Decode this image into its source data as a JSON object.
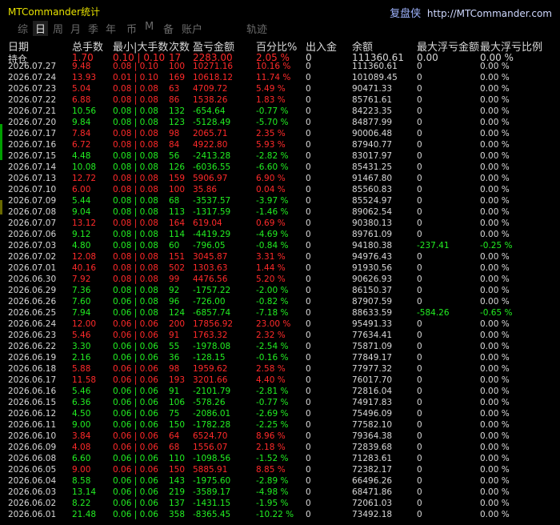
{
  "window": {
    "title": "MTCommander统计",
    "brand": "复盘侠",
    "url": "http://MTCommander.com"
  },
  "tabs": [
    "综",
    "日",
    "周",
    "月",
    "季",
    "年",
    "币",
    "M",
    "备",
    "账户",
    "轨迹"
  ],
  "active_tab": "日",
  "headers": [
    "日期",
    "总手数",
    "最小|大手数",
    "次数",
    "盈亏金额",
    "百分比%",
    "出入金",
    "余额",
    "最大浮亏金额",
    "最大浮亏比例"
  ],
  "holding": {
    "label": "持仓",
    "lots": "1.70",
    "minmax": "0.10 | 0.10",
    "count": "17",
    "pnl": "2283.00",
    "pct": "2.05 %",
    "io": "0",
    "balance": "111360.61",
    "maxfloat": "0.00",
    "maxfloatpct": "0.00 %",
    "color": "red"
  },
  "rows": [
    {
      "date": "2026.07.27",
      "lots": "9.48",
      "minmax": "0.08 | 0.10",
      "count": "100",
      "pnl": "10271.16",
      "pct": "10.16 %",
      "io": "0",
      "balance": "111360.61",
      "maxfloat": "0",
      "maxfloatpct": "0.00 %",
      "color": "red"
    },
    {
      "date": "2026.07.24",
      "lots": "13.93",
      "minmax": "0.01 | 0.10",
      "count": "169",
      "pnl": "10618.12",
      "pct": "11.74 %",
      "io": "0",
      "balance": "101089.45",
      "maxfloat": "0",
      "maxfloatpct": "0.00 %",
      "color": "red"
    },
    {
      "date": "2026.07.23",
      "lots": "5.04",
      "minmax": "0.08 | 0.08",
      "count": "63",
      "pnl": "4709.72",
      "pct": "5.49 %",
      "io": "0",
      "balance": "90471.33",
      "maxfloat": "0",
      "maxfloatpct": "0.00 %",
      "color": "red"
    },
    {
      "date": "2026.07.22",
      "lots": "6.88",
      "minmax": "0.08 | 0.08",
      "count": "86",
      "pnl": "1538.26",
      "pct": "1.83 %",
      "io": "0",
      "balance": "85761.61",
      "maxfloat": "0",
      "maxfloatpct": "0.00 %",
      "color": "red"
    },
    {
      "date": "2026.07.21",
      "lots": "10.56",
      "minmax": "0.08 | 0.08",
      "count": "132",
      "pnl": "-654.64",
      "pct": "-0.77 %",
      "io": "0",
      "balance": "84223.35",
      "maxfloat": "0",
      "maxfloatpct": "0.00 %",
      "color": "green"
    },
    {
      "date": "2026.07.20",
      "lots": "9.84",
      "minmax": "0.08 | 0.08",
      "count": "123",
      "pnl": "-5128.49",
      "pct": "-5.70 %",
      "io": "0",
      "balance": "84877.99",
      "maxfloat": "0",
      "maxfloatpct": "0.00 %",
      "color": "green"
    },
    {
      "date": "2026.07.17",
      "lots": "7.84",
      "minmax": "0.08 | 0.08",
      "count": "98",
      "pnl": "2065.71",
      "pct": "2.35 %",
      "io": "0",
      "balance": "90006.48",
      "maxfloat": "0",
      "maxfloatpct": "0.00 %",
      "color": "red"
    },
    {
      "date": "2026.07.16",
      "lots": "6.72",
      "minmax": "0.08 | 0.08",
      "count": "84",
      "pnl": "4922.80",
      "pct": "5.93 %",
      "io": "0",
      "balance": "87940.77",
      "maxfloat": "0",
      "maxfloatpct": "0.00 %",
      "color": "red"
    },
    {
      "date": "2026.07.15",
      "lots": "4.48",
      "minmax": "0.08 | 0.08",
      "count": "56",
      "pnl": "-2413.28",
      "pct": "-2.82 %",
      "io": "0",
      "balance": "83017.97",
      "maxfloat": "0",
      "maxfloatpct": "0.00 %",
      "color": "green"
    },
    {
      "date": "2026.07.14",
      "lots": "10.08",
      "minmax": "0.08 | 0.08",
      "count": "126",
      "pnl": "-6036.55",
      "pct": "-6.60 %",
      "io": "0",
      "balance": "85431.25",
      "maxfloat": "0",
      "maxfloatpct": "0.00 %",
      "color": "green"
    },
    {
      "date": "2026.07.13",
      "lots": "12.72",
      "minmax": "0.08 | 0.08",
      "count": "159",
      "pnl": "5906.97",
      "pct": "6.90 %",
      "io": "0",
      "balance": "91467.80",
      "maxfloat": "0",
      "maxfloatpct": "0.00 %",
      "color": "red"
    },
    {
      "date": "2026.07.10",
      "lots": "6.00",
      "minmax": "0.08 | 0.08",
      "count": "100",
      "pnl": "35.86",
      "pct": "0.04 %",
      "io": "0",
      "balance": "85560.83",
      "maxfloat": "0",
      "maxfloatpct": "0.00 %",
      "color": "red"
    },
    {
      "date": "2026.07.09",
      "lots": "5.44",
      "minmax": "0.08 | 0.08",
      "count": "68",
      "pnl": "-3537.57",
      "pct": "-3.97 %",
      "io": "0",
      "balance": "85524.97",
      "maxfloat": "0",
      "maxfloatpct": "0.00 %",
      "color": "green"
    },
    {
      "date": "2026.07.08",
      "lots": "9.04",
      "minmax": "0.08 | 0.08",
      "count": "113",
      "pnl": "-1317.59",
      "pct": "-1.46 %",
      "io": "0",
      "balance": "89062.54",
      "maxfloat": "0",
      "maxfloatpct": "0.00 %",
      "color": "green"
    },
    {
      "date": "2026.07.07",
      "lots": "13.12",
      "minmax": "0.08 | 0.08",
      "count": "164",
      "pnl": "619.04",
      "pct": "0.69 %",
      "io": "0",
      "balance": "90380.13",
      "maxfloat": "0",
      "maxfloatpct": "0.00 %",
      "color": "red"
    },
    {
      "date": "2026.07.06",
      "lots": "9.12",
      "minmax": "0.08 | 0.08",
      "count": "114",
      "pnl": "-4419.29",
      "pct": "-4.69 %",
      "io": "0",
      "balance": "89761.09",
      "maxfloat": "0",
      "maxfloatpct": "0.00 %",
      "color": "green"
    },
    {
      "date": "2026.07.03",
      "lots": "4.80",
      "minmax": "0.08 | 0.08",
      "count": "60",
      "pnl": "-796.05",
      "pct": "-0.84 %",
      "io": "0",
      "balance": "94180.38",
      "maxfloat": "-237.41",
      "maxfloatpct": "-0.25 %",
      "color": "green"
    },
    {
      "date": "2026.07.02",
      "lots": "12.08",
      "minmax": "0.08 | 0.08",
      "count": "151",
      "pnl": "3045.87",
      "pct": "3.31 %",
      "io": "0",
      "balance": "94976.43",
      "maxfloat": "0",
      "maxfloatpct": "0.00 %",
      "color": "red"
    },
    {
      "date": "2026.07.01",
      "lots": "40.16",
      "minmax": "0.08 | 0.08",
      "count": "502",
      "pnl": "1303.63",
      "pct": "1.44 %",
      "io": "0",
      "balance": "91930.56",
      "maxfloat": "0",
      "maxfloatpct": "0.00 %",
      "color": "red"
    },
    {
      "date": "2026.06.30",
      "lots": "7.92",
      "minmax": "0.08 | 0.08",
      "count": "99",
      "pnl": "4476.56",
      "pct": "5.20 %",
      "io": "0",
      "balance": "90626.93",
      "maxfloat": "0",
      "maxfloatpct": "0.00 %",
      "color": "red"
    },
    {
      "date": "2026.06.29",
      "lots": "7.36",
      "minmax": "0.08 | 0.08",
      "count": "92",
      "pnl": "-1757.22",
      "pct": "-2.00 %",
      "io": "0",
      "balance": "86150.37",
      "maxfloat": "0",
      "maxfloatpct": "0.00 %",
      "color": "green"
    },
    {
      "date": "2026.06.26",
      "lots": "7.60",
      "minmax": "0.06 | 0.08",
      "count": "96",
      "pnl": "-726.00",
      "pct": "-0.82 %",
      "io": "0",
      "balance": "87907.59",
      "maxfloat": "0",
      "maxfloatpct": "0.00 %",
      "color": "green"
    },
    {
      "date": "2026.06.25",
      "lots": "7.94",
      "minmax": "0.06 | 0.08",
      "count": "124",
      "pnl": "-6857.74",
      "pct": "-7.18 %",
      "io": "0",
      "balance": "88633.59",
      "maxfloat": "-584.26",
      "maxfloatpct": "-0.65 %",
      "color": "green"
    },
    {
      "date": "2026.06.24",
      "lots": "12.00",
      "minmax": "0.06 | 0.06",
      "count": "200",
      "pnl": "17856.92",
      "pct": "23.00 %",
      "io": "0",
      "balance": "95491.33",
      "maxfloat": "0",
      "maxfloatpct": "0.00 %",
      "color": "red"
    },
    {
      "date": "2026.06.23",
      "lots": "5.46",
      "minmax": "0.06 | 0.06",
      "count": "91",
      "pnl": "1763.32",
      "pct": "2.32 %",
      "io": "0",
      "balance": "77634.41",
      "maxfloat": "0",
      "maxfloatpct": "0.00 %",
      "color": "red"
    },
    {
      "date": "2026.06.22",
      "lots": "3.30",
      "minmax": "0.06 | 0.06",
      "count": "55",
      "pnl": "-1978.08",
      "pct": "-2.54 %",
      "io": "0",
      "balance": "75871.09",
      "maxfloat": "0",
      "maxfloatpct": "0.00 %",
      "color": "green"
    },
    {
      "date": "2026.06.19",
      "lots": "2.16",
      "minmax": "0.06 | 0.06",
      "count": "36",
      "pnl": "-128.15",
      "pct": "-0.16 %",
      "io": "0",
      "balance": "77849.17",
      "maxfloat": "0",
      "maxfloatpct": "0.00 %",
      "color": "green"
    },
    {
      "date": "2026.06.18",
      "lots": "5.88",
      "minmax": "0.06 | 0.06",
      "count": "98",
      "pnl": "1959.62",
      "pct": "2.58 %",
      "io": "0",
      "balance": "77977.32",
      "maxfloat": "0",
      "maxfloatpct": "0.00 %",
      "color": "red"
    },
    {
      "date": "2026.06.17",
      "lots": "11.58",
      "minmax": "0.06 | 0.06",
      "count": "193",
      "pnl": "3201.66",
      "pct": "4.40 %",
      "io": "0",
      "balance": "76017.70",
      "maxfloat": "0",
      "maxfloatpct": "0.00 %",
      "color": "red"
    },
    {
      "date": "2026.06.16",
      "lots": "5.46",
      "minmax": "0.06 | 0.06",
      "count": "91",
      "pnl": "-2101.79",
      "pct": "-2.81 %",
      "io": "0",
      "balance": "72816.04",
      "maxfloat": "0",
      "maxfloatpct": "0.00 %",
      "color": "green"
    },
    {
      "date": "2026.06.15",
      "lots": "6.36",
      "minmax": "0.06 | 0.06",
      "count": "106",
      "pnl": "-578.26",
      "pct": "-0.77 %",
      "io": "0",
      "balance": "74917.83",
      "maxfloat": "0",
      "maxfloatpct": "0.00 %",
      "color": "green"
    },
    {
      "date": "2026.06.12",
      "lots": "4.50",
      "minmax": "0.06 | 0.06",
      "count": "75",
      "pnl": "-2086.01",
      "pct": "-2.69 %",
      "io": "0",
      "balance": "75496.09",
      "maxfloat": "0",
      "maxfloatpct": "0.00 %",
      "color": "green"
    },
    {
      "date": "2026.06.11",
      "lots": "9.00",
      "minmax": "0.06 | 0.06",
      "count": "150",
      "pnl": "-1782.28",
      "pct": "-2.25 %",
      "io": "0",
      "balance": "77582.10",
      "maxfloat": "0",
      "maxfloatpct": "0.00 %",
      "color": "green"
    },
    {
      "date": "2026.06.10",
      "lots": "3.84",
      "minmax": "0.06 | 0.06",
      "count": "64",
      "pnl": "6524.70",
      "pct": "8.96 %",
      "io": "0",
      "balance": "79364.38",
      "maxfloat": "0",
      "maxfloatpct": "0.00 %",
      "color": "red"
    },
    {
      "date": "2026.06.09",
      "lots": "4.08",
      "minmax": "0.06 | 0.06",
      "count": "68",
      "pnl": "1556.07",
      "pct": "2.18 %",
      "io": "0",
      "balance": "72839.68",
      "maxfloat": "0",
      "maxfloatpct": "0.00 %",
      "color": "red"
    },
    {
      "date": "2026.06.08",
      "lots": "6.60",
      "minmax": "0.06 | 0.06",
      "count": "110",
      "pnl": "-1098.56",
      "pct": "-1.52 %",
      "io": "0",
      "balance": "71283.61",
      "maxfloat": "0",
      "maxfloatpct": "0.00 %",
      "color": "green"
    },
    {
      "date": "2026.06.05",
      "lots": "9.00",
      "minmax": "0.06 | 0.06",
      "count": "150",
      "pnl": "5885.91",
      "pct": "8.85 %",
      "io": "0",
      "balance": "72382.17",
      "maxfloat": "0",
      "maxfloatpct": "0.00 %",
      "color": "red"
    },
    {
      "date": "2026.06.04",
      "lots": "8.58",
      "minmax": "0.06 | 0.06",
      "count": "143",
      "pnl": "-1975.60",
      "pct": "-2.89 %",
      "io": "0",
      "balance": "66496.26",
      "maxfloat": "0",
      "maxfloatpct": "0.00 %",
      "color": "green"
    },
    {
      "date": "2026.06.03",
      "lots": "13.14",
      "minmax": "0.06 | 0.06",
      "count": "219",
      "pnl": "-3589.17",
      "pct": "-4.98 %",
      "io": "0",
      "balance": "68471.86",
      "maxfloat": "0",
      "maxfloatpct": "0.00 %",
      "color": "green"
    },
    {
      "date": "2026.06.02",
      "lots": "8.22",
      "minmax": "0.06 | 0.06",
      "count": "137",
      "pnl": "-1431.15",
      "pct": "-1.95 %",
      "io": "0",
      "balance": "72061.03",
      "maxfloat": "0",
      "maxfloatpct": "0.00 %",
      "color": "green"
    },
    {
      "date": "2026.06.01",
      "lots": "21.48",
      "minmax": "0.06 | 0.06",
      "count": "358",
      "pnl": "-8365.45",
      "pct": "-10.22 %",
      "io": "0",
      "balance": "73492.18",
      "maxfloat": "0",
      "maxfloatpct": "0.00 %",
      "color": "green"
    }
  ],
  "colors": {
    "profit": "#ff2a2a",
    "loss": "#22ee22",
    "title": "#e8e200",
    "header": "#d8d8d8"
  }
}
